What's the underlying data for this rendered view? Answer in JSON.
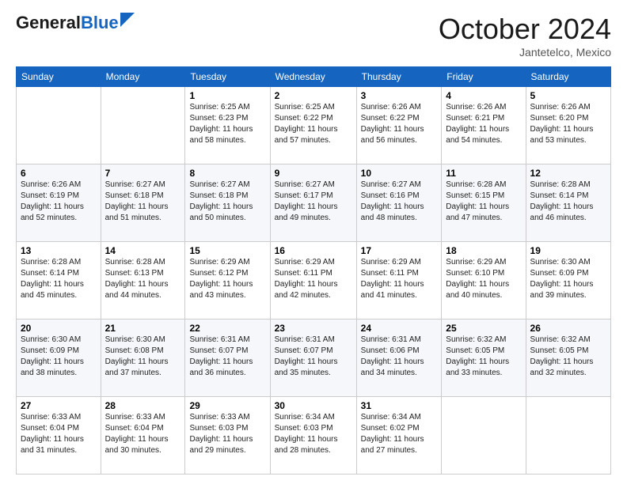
{
  "header": {
    "logo_line1": "General",
    "logo_line2": "Blue",
    "month": "October 2024",
    "location": "Jantetelco, Mexico"
  },
  "weekdays": [
    "Sunday",
    "Monday",
    "Tuesday",
    "Wednesday",
    "Thursday",
    "Friday",
    "Saturday"
  ],
  "weeks": [
    [
      {
        "day": "",
        "sunrise": "",
        "sunset": "",
        "daylight": ""
      },
      {
        "day": "",
        "sunrise": "",
        "sunset": "",
        "daylight": ""
      },
      {
        "day": "1",
        "sunrise": "Sunrise: 6:25 AM",
        "sunset": "Sunset: 6:23 PM",
        "daylight": "Daylight: 11 hours and 58 minutes."
      },
      {
        "day": "2",
        "sunrise": "Sunrise: 6:25 AM",
        "sunset": "Sunset: 6:22 PM",
        "daylight": "Daylight: 11 hours and 57 minutes."
      },
      {
        "day": "3",
        "sunrise": "Sunrise: 6:26 AM",
        "sunset": "Sunset: 6:22 PM",
        "daylight": "Daylight: 11 hours and 56 minutes."
      },
      {
        "day": "4",
        "sunrise": "Sunrise: 6:26 AM",
        "sunset": "Sunset: 6:21 PM",
        "daylight": "Daylight: 11 hours and 54 minutes."
      },
      {
        "day": "5",
        "sunrise": "Sunrise: 6:26 AM",
        "sunset": "Sunset: 6:20 PM",
        "daylight": "Daylight: 11 hours and 53 minutes."
      }
    ],
    [
      {
        "day": "6",
        "sunrise": "Sunrise: 6:26 AM",
        "sunset": "Sunset: 6:19 PM",
        "daylight": "Daylight: 11 hours and 52 minutes."
      },
      {
        "day": "7",
        "sunrise": "Sunrise: 6:27 AM",
        "sunset": "Sunset: 6:18 PM",
        "daylight": "Daylight: 11 hours and 51 minutes."
      },
      {
        "day": "8",
        "sunrise": "Sunrise: 6:27 AM",
        "sunset": "Sunset: 6:18 PM",
        "daylight": "Daylight: 11 hours and 50 minutes."
      },
      {
        "day": "9",
        "sunrise": "Sunrise: 6:27 AM",
        "sunset": "Sunset: 6:17 PM",
        "daylight": "Daylight: 11 hours and 49 minutes."
      },
      {
        "day": "10",
        "sunrise": "Sunrise: 6:27 AM",
        "sunset": "Sunset: 6:16 PM",
        "daylight": "Daylight: 11 hours and 48 minutes."
      },
      {
        "day": "11",
        "sunrise": "Sunrise: 6:28 AM",
        "sunset": "Sunset: 6:15 PM",
        "daylight": "Daylight: 11 hours and 47 minutes."
      },
      {
        "day": "12",
        "sunrise": "Sunrise: 6:28 AM",
        "sunset": "Sunset: 6:14 PM",
        "daylight": "Daylight: 11 hours and 46 minutes."
      }
    ],
    [
      {
        "day": "13",
        "sunrise": "Sunrise: 6:28 AM",
        "sunset": "Sunset: 6:14 PM",
        "daylight": "Daylight: 11 hours and 45 minutes."
      },
      {
        "day": "14",
        "sunrise": "Sunrise: 6:28 AM",
        "sunset": "Sunset: 6:13 PM",
        "daylight": "Daylight: 11 hours and 44 minutes."
      },
      {
        "day": "15",
        "sunrise": "Sunrise: 6:29 AM",
        "sunset": "Sunset: 6:12 PM",
        "daylight": "Daylight: 11 hours and 43 minutes."
      },
      {
        "day": "16",
        "sunrise": "Sunrise: 6:29 AM",
        "sunset": "Sunset: 6:11 PM",
        "daylight": "Daylight: 11 hours and 42 minutes."
      },
      {
        "day": "17",
        "sunrise": "Sunrise: 6:29 AM",
        "sunset": "Sunset: 6:11 PM",
        "daylight": "Daylight: 11 hours and 41 minutes."
      },
      {
        "day": "18",
        "sunrise": "Sunrise: 6:29 AM",
        "sunset": "Sunset: 6:10 PM",
        "daylight": "Daylight: 11 hours and 40 minutes."
      },
      {
        "day": "19",
        "sunrise": "Sunrise: 6:30 AM",
        "sunset": "Sunset: 6:09 PM",
        "daylight": "Daylight: 11 hours and 39 minutes."
      }
    ],
    [
      {
        "day": "20",
        "sunrise": "Sunrise: 6:30 AM",
        "sunset": "Sunset: 6:09 PM",
        "daylight": "Daylight: 11 hours and 38 minutes."
      },
      {
        "day": "21",
        "sunrise": "Sunrise: 6:30 AM",
        "sunset": "Sunset: 6:08 PM",
        "daylight": "Daylight: 11 hours and 37 minutes."
      },
      {
        "day": "22",
        "sunrise": "Sunrise: 6:31 AM",
        "sunset": "Sunset: 6:07 PM",
        "daylight": "Daylight: 11 hours and 36 minutes."
      },
      {
        "day": "23",
        "sunrise": "Sunrise: 6:31 AM",
        "sunset": "Sunset: 6:07 PM",
        "daylight": "Daylight: 11 hours and 35 minutes."
      },
      {
        "day": "24",
        "sunrise": "Sunrise: 6:31 AM",
        "sunset": "Sunset: 6:06 PM",
        "daylight": "Daylight: 11 hours and 34 minutes."
      },
      {
        "day": "25",
        "sunrise": "Sunrise: 6:32 AM",
        "sunset": "Sunset: 6:05 PM",
        "daylight": "Daylight: 11 hours and 33 minutes."
      },
      {
        "day": "26",
        "sunrise": "Sunrise: 6:32 AM",
        "sunset": "Sunset: 6:05 PM",
        "daylight": "Daylight: 11 hours and 32 minutes."
      }
    ],
    [
      {
        "day": "27",
        "sunrise": "Sunrise: 6:33 AM",
        "sunset": "Sunset: 6:04 PM",
        "daylight": "Daylight: 11 hours and 31 minutes."
      },
      {
        "day": "28",
        "sunrise": "Sunrise: 6:33 AM",
        "sunset": "Sunset: 6:04 PM",
        "daylight": "Daylight: 11 hours and 30 minutes."
      },
      {
        "day": "29",
        "sunrise": "Sunrise: 6:33 AM",
        "sunset": "Sunset: 6:03 PM",
        "daylight": "Daylight: 11 hours and 29 minutes."
      },
      {
        "day": "30",
        "sunrise": "Sunrise: 6:34 AM",
        "sunset": "Sunset: 6:03 PM",
        "daylight": "Daylight: 11 hours and 28 minutes."
      },
      {
        "day": "31",
        "sunrise": "Sunrise: 6:34 AM",
        "sunset": "Sunset: 6:02 PM",
        "daylight": "Daylight: 11 hours and 27 minutes."
      },
      {
        "day": "",
        "sunrise": "",
        "sunset": "",
        "daylight": ""
      },
      {
        "day": "",
        "sunrise": "",
        "sunset": "",
        "daylight": ""
      }
    ]
  ]
}
